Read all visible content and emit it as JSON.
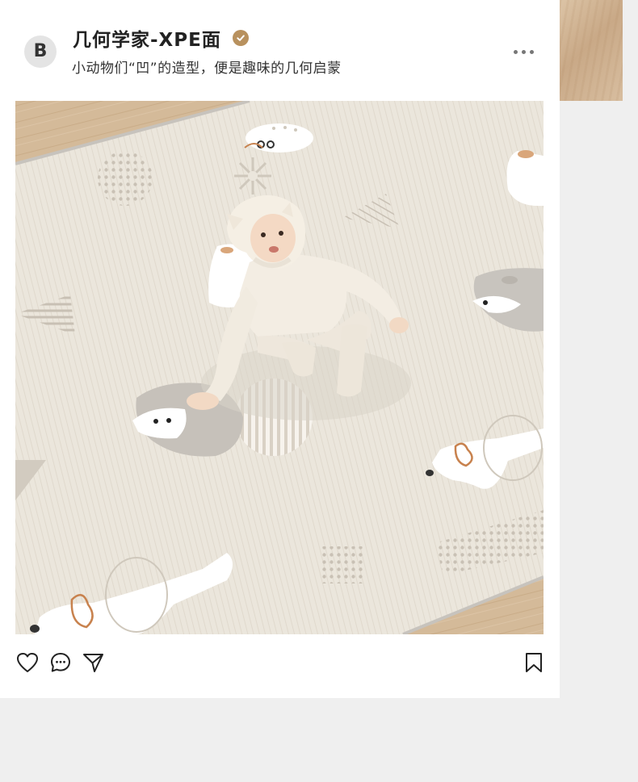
{
  "post": {
    "author_initial": "B",
    "title": "几何学家-XPE面",
    "subtitle": "小动物们“凹”的造型，便是趣味的几何启蒙"
  },
  "icons": {
    "verified": "verified-badge-icon",
    "more": "more-dots-icon",
    "like": "heart-icon",
    "comment": "comment-bubble-icon",
    "share": "send-icon",
    "save": "bookmark-icon"
  },
  "colors": {
    "badge": "#b8915e",
    "page_background": "#efefef",
    "card_background": "#ffffff",
    "mat": "#ebe5db",
    "floor": "#d2b796",
    "dog_ear": "#c8824e"
  }
}
